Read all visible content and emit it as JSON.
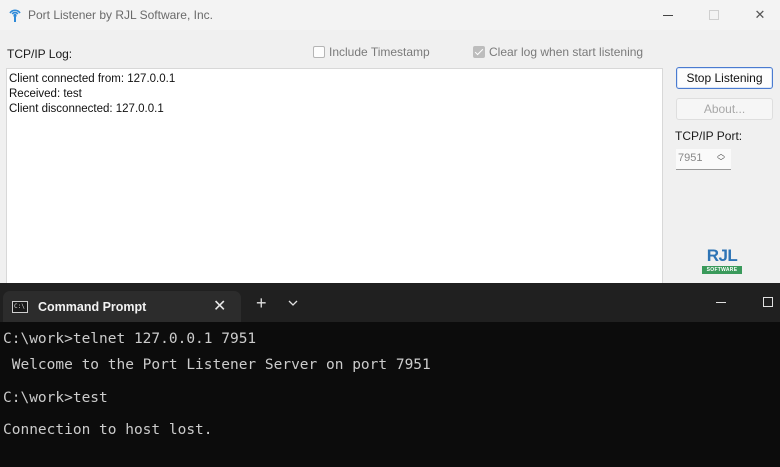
{
  "app": {
    "title": "Port Listener by RJL Software, Inc.",
    "log_label": "TCP/IP Log:",
    "include_timestamp": {
      "label": "Include Timestamp",
      "checked": false
    },
    "clear_log": {
      "label": "Clear log when start listening",
      "checked": true
    },
    "log_lines": [
      "Client connected from: 127.0.0.1",
      "Received: test",
      "Client disconnected: 127.0.0.1"
    ],
    "stop_button": "Stop Listening",
    "about_button": "About...",
    "port_label": "TCP/IP Port:",
    "port_value": "7951",
    "logo": {
      "text": "RJL",
      "sub": "SOFTWARE"
    }
  },
  "terminal": {
    "tab_title": "Command Prompt",
    "lines": [
      "C:\\work>telnet 127.0.0.1 7951",
      " Welcome to the Port Listener Server on port 7951",
      "C:\\work>test",
      "Connection to host lost."
    ]
  },
  "colors": {
    "accent": "#4a7bd0",
    "logo_blue": "#2e74b5",
    "logo_green": "#3a9a5b",
    "terminal_bg": "#0c0c0c"
  }
}
